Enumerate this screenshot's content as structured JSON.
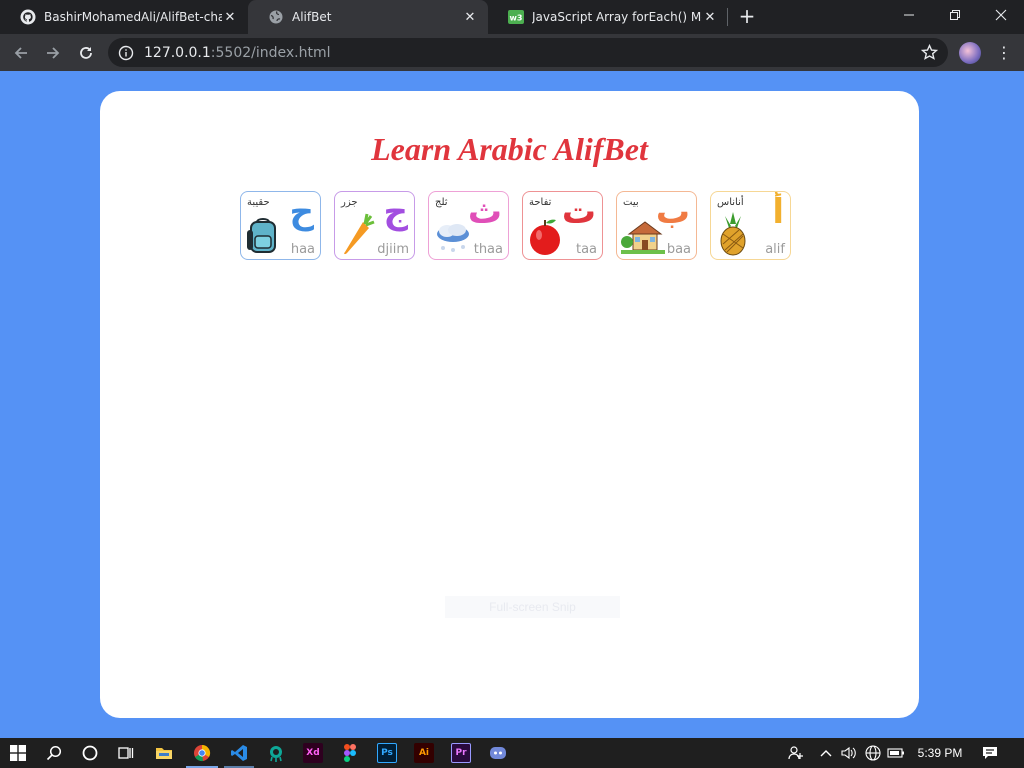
{
  "browser": {
    "tabs": [
      {
        "title": "BashirMohamedAli/AlifBet-challe",
        "icon": "github-icon",
        "active": false
      },
      {
        "title": "AlifBet",
        "icon": "globe-icon",
        "active": true
      },
      {
        "title": "JavaScript Array forEach() Method",
        "icon": "w3schools-icon",
        "active": false
      }
    ],
    "new_tab": "+",
    "url_host": "127.0.0.1",
    "url_rest": ":5502/index.html"
  },
  "page": {
    "title": "Learn Arabic AlifBet",
    "background_color": "#5592f5",
    "title_color": "#e0353d",
    "cards": [
      {
        "letter": "ح",
        "word": "حقيبة",
        "translit": "haa",
        "picture": "backpack-icon",
        "color": "#3d8be0",
        "border": "#8fb7ea"
      },
      {
        "letter": "ج",
        "word": "جزر",
        "translit": "djiim",
        "picture": "carrot-icon",
        "color": "#a24ee0",
        "border": "#c79be8"
      },
      {
        "letter": "ث",
        "word": "ثلج",
        "translit": "thaa",
        "picture": "snow-cloud-icon",
        "color": "#e04fb8",
        "border": "#eea1d6"
      },
      {
        "letter": "ت",
        "word": "تفاحة",
        "translit": "taa",
        "picture": "apple-icon",
        "color": "#e0353d",
        "border": "#ee9294"
      },
      {
        "letter": "ب",
        "word": "بيت",
        "translit": "baa",
        "picture": "house-icon",
        "color": "#f07b43",
        "border": "#f4b894"
      },
      {
        "letter": "أ",
        "word": "أناناس",
        "translit": "alif",
        "picture": "pineapple-icon",
        "color": "#f2b02e",
        "border": "#f6d795"
      }
    ],
    "fullscreen_tip": "Full-screen Snip"
  },
  "taskbar": {
    "clock": "5:39 PM",
    "apps": [
      "windows-start-icon",
      "search-icon",
      "cortana-icon",
      "task-view-icon",
      "file-explorer-icon",
      "chrome-icon",
      "vscode-icon",
      "gitkraken-icon",
      "adobe-xd-icon",
      "figma-icon",
      "photoshop-icon",
      "illustrator-icon",
      "premiere-icon",
      "discord-icon"
    ],
    "xd_label": "Xd",
    "ps_label": "Ps",
    "ai_label": "Ai",
    "pr_label": "Pr"
  }
}
